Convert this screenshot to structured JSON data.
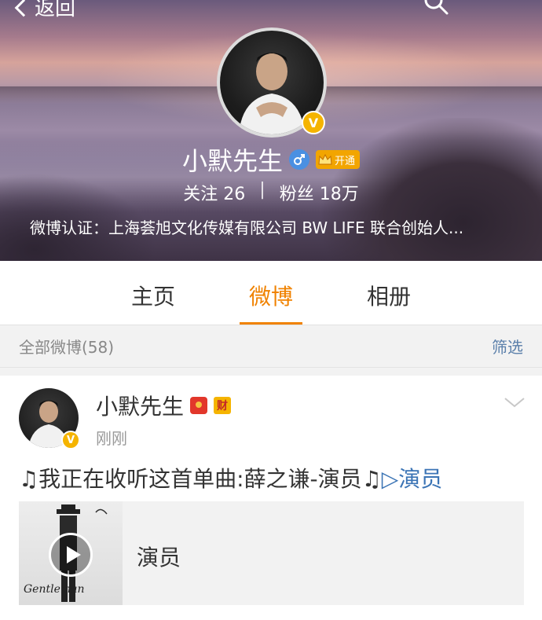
{
  "header": {
    "back_label": "返回",
    "profile_name": "小默先生",
    "vip_label": "开通",
    "verified_mark": "V",
    "following_label": "关注",
    "following_count": "26",
    "separator": "|",
    "followers_label": "粉丝",
    "followers_count": "18万",
    "verification": "微博认证：上海荟旭文化传媒有限公司 BW LIFE 联合创始人..."
  },
  "tabs": [
    {
      "label": "主页"
    },
    {
      "label": "微博"
    },
    {
      "label": "相册"
    }
  ],
  "filter_bar": {
    "count_label": "全部微博(58)",
    "filter_label": "筛选"
  },
  "post": {
    "author": "小默先生",
    "badge_cai": "财",
    "time": "刚刚",
    "text_prefix": "♫我正在收听这首单曲:薛之谦-演员♫",
    "link_text": "▷演员",
    "music_title": "演员",
    "album_signature": "Gentleman"
  },
  "colors": {
    "accent": "#f08200",
    "link": "#3b74b5",
    "filter_link": "#5a7faa",
    "verified_badge": "#f5b400"
  },
  "icons": [
    "back-chevron-icon",
    "search-icon",
    "verified-v-icon",
    "male-gender-icon",
    "crown-icon",
    "red-envelope-icon",
    "chevron-down-icon",
    "play-icon"
  ]
}
